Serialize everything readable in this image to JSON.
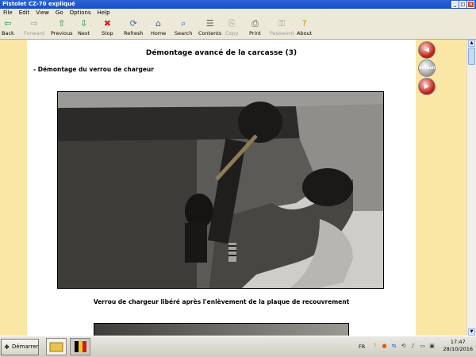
{
  "window": {
    "title": "Pistolet CZ-70 expliqué"
  },
  "menu": [
    "File",
    "Edit",
    "View",
    "Go",
    "Options",
    "Help"
  ],
  "toolbar": [
    {
      "label": "Back",
      "icon": "back-arrow-icon",
      "glyph": "⇦",
      "color": "#1f8a3a",
      "enabled": true
    },
    {
      "label": "Forward",
      "icon": "forward-arrow-icon",
      "glyph": "⇨",
      "color": "#9d9d9d",
      "enabled": false
    },
    {
      "label": "Previous",
      "icon": "previous-up-arrow-icon",
      "glyph": "⇧",
      "color": "#1f8a3a",
      "enabled": true
    },
    {
      "label": "Next",
      "icon": "next-down-arrow-icon",
      "glyph": "⇩",
      "color": "#1f8a3a",
      "enabled": true
    },
    {
      "label": "Stop",
      "icon": "stop-icon",
      "glyph": "✖",
      "color": "#d41d1d",
      "enabled": true
    },
    {
      "label": "Refresh",
      "icon": "refresh-icon",
      "glyph": "⟳",
      "color": "#3b63b8",
      "enabled": true
    },
    {
      "label": "Home",
      "icon": "home-icon",
      "glyph": "⌂",
      "color": "#3b63b8",
      "enabled": true
    },
    {
      "label": "Search",
      "icon": "search-icon",
      "glyph": "⌕",
      "color": "#3b63b8",
      "enabled": true
    },
    {
      "label": "Contents",
      "icon": "contents-icon",
      "glyph": "☰",
      "color": "#555",
      "enabled": true
    },
    {
      "label": "Copy",
      "icon": "copy-icon",
      "glyph": "⎘",
      "color": "#9d9d9d",
      "enabled": false
    },
    {
      "label": "Print",
      "icon": "print-icon",
      "glyph": "⎙",
      "color": "#555",
      "enabled": true
    },
    {
      "label": "Password",
      "icon": "password-key-icon",
      "glyph": "⚿",
      "color": "#9d9d9d",
      "enabled": false
    },
    {
      "label": "About",
      "icon": "about-icon",
      "glyph": "?",
      "color": "#c69a00",
      "enabled": true
    }
  ],
  "page": {
    "title": "Démontage avancé de la carcasse (3)",
    "subheading": "- Démontage du verrou de chargeur",
    "caption": "Verrou de chargeur libéré après l'enlèvement de la plaque de recouvrement"
  },
  "side_nav": {
    "prev_glyph": "◀",
    "home_label": "Accueil",
    "next_glyph": "▶"
  },
  "taskbar": {
    "start_label": "Démarrer",
    "language": "FR",
    "time": "17:47",
    "date": "28/10/2016"
  },
  "colors": {
    "side_panel": "#fbe7a5",
    "titlebar": "#1f57cc"
  }
}
